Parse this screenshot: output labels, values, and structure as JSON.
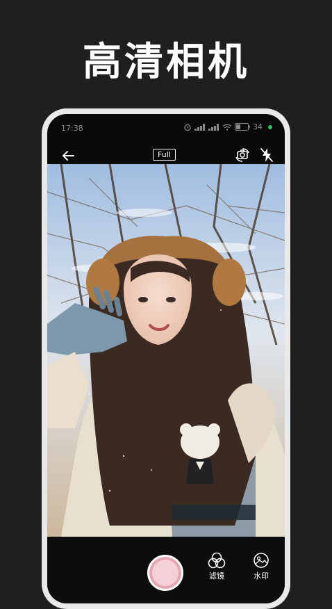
{
  "headline": "高清相机",
  "status_bar": {
    "time": "17:38",
    "battery": "34"
  },
  "toolbar": {
    "mode_label": "Full"
  },
  "bottom_bar": {
    "filter_label": "滤镜",
    "watermark_label": "水印"
  },
  "colors": {
    "background": "#1f1f1f",
    "phone_frame": "#e9e9e9",
    "shutter": "#f3d1d6",
    "status_dot": "#22c55e"
  }
}
